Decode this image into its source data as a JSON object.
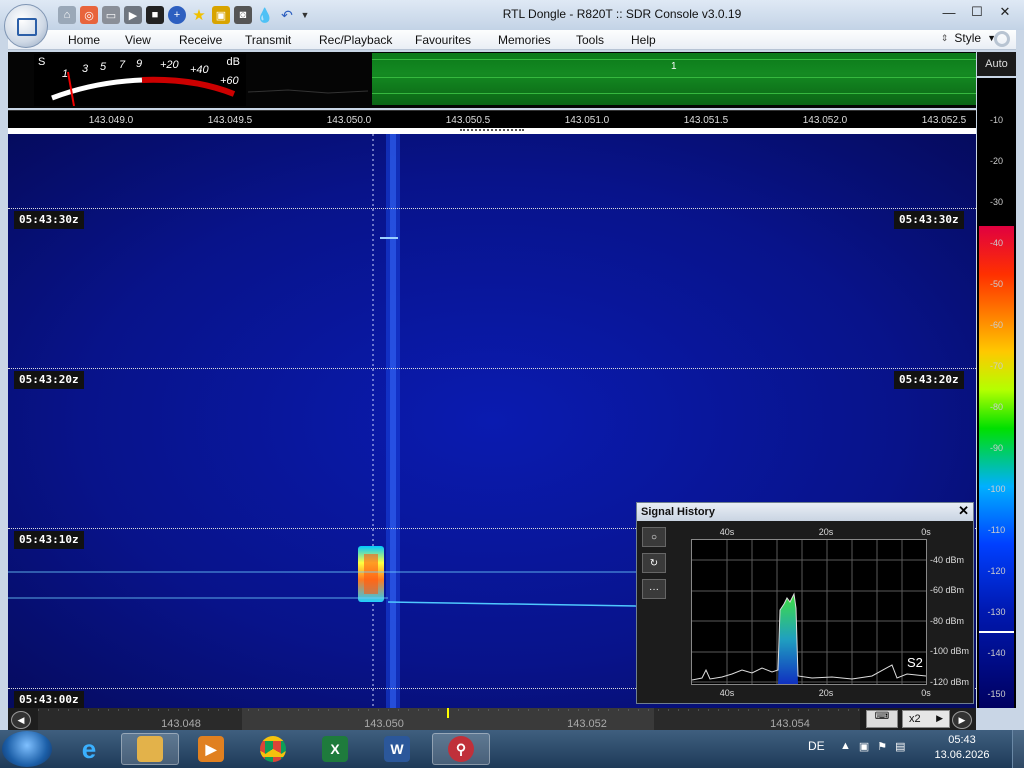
{
  "window": {
    "title": "RTL Dongle - R820T :: SDR Console v3.0.19",
    "controls": [
      "minimize-icon",
      "maximize-icon",
      "close-icon"
    ]
  },
  "quick_access": [
    "home-icon",
    "lifebuoy-icon",
    "folder-icon",
    "play-icon",
    "stop-icon",
    "plus-icon",
    "star-icon",
    "lock-icon",
    "camera-icon",
    "drop-icon",
    "undo-icon",
    "dropdown-arrow-icon"
  ],
  "menu": {
    "items": [
      "Home",
      "View",
      "Receive",
      "Transmit",
      "Rec/Playback",
      "Favourites",
      "Memories",
      "Tools",
      "Help"
    ],
    "style_label": "Style"
  },
  "smeter": {
    "s_label": "S",
    "db_label": "dB",
    "scale": [
      "1",
      "3",
      "5",
      "7",
      "9",
      "+20",
      "+40",
      "+60"
    ]
  },
  "spectrum": {
    "vfo_marker": "1",
    "freq_ticks": [
      "143.049.0",
      "143.049.5",
      "143.050.0",
      "143.050.5",
      "143.051.0",
      "143.051.5",
      "143.052.0",
      "143.052.5"
    ],
    "auto_label": "Auto",
    "db_scale": [
      "-10",
      "-20",
      "-30",
      "-40",
      "-50",
      "-60",
      "-70",
      "-80",
      "-90",
      "-100",
      "-110",
      "-120",
      "-130",
      "-140",
      "-150"
    ]
  },
  "waterfall": {
    "time_labels": [
      "05:43:30z",
      "05:43:20z",
      "05:43:10z",
      "05:43:00z"
    ]
  },
  "signal_history": {
    "title": "Signal History",
    "close": "✕",
    "buttons": [
      "○",
      "↻",
      "···"
    ],
    "x_labels": [
      "40s",
      "20s",
      "0s"
    ],
    "y_labels": [
      "-40 dBm",
      "-60 dBm",
      "-80 dBm",
      "-100 dBm",
      "-120 dBm"
    ],
    "s_reading": "S2"
  },
  "bottom": {
    "freqs": [
      "143.048",
      "143.050",
      "143.052",
      "143.054"
    ],
    "zoom": "x2"
  },
  "taskbar": {
    "apps": [
      "internet-explorer-icon",
      "file-explorer-icon",
      "media-player-icon",
      "chrome-icon",
      "excel-icon",
      "word-icon",
      "sdr-console-icon"
    ],
    "language": "DE",
    "time": "05:43",
    "date": "13.06.2026"
  }
}
